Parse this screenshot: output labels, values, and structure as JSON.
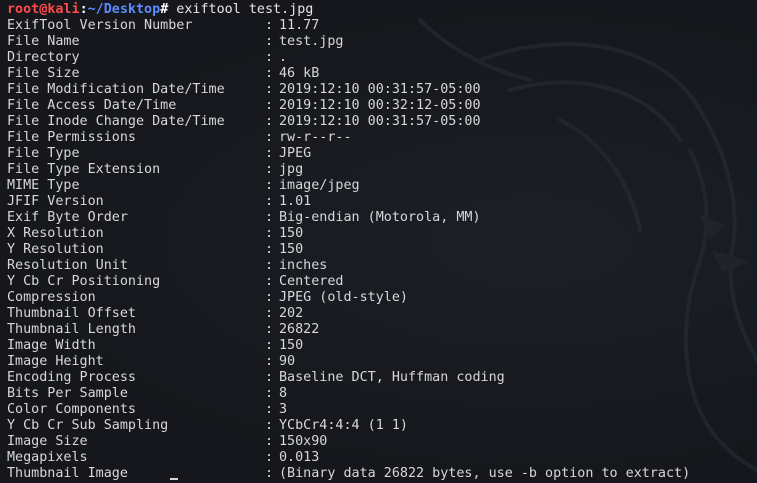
{
  "prompt": {
    "user": "root",
    "at": "@",
    "host": "kali",
    "colon": ":",
    "path": "~/Desktop",
    "hash": "#",
    "command": " exiftool test.jpg"
  },
  "separator": ":",
  "rows": [
    {
      "tag": "ExifTool Version Number",
      "value": "11.77"
    },
    {
      "tag": "File Name",
      "value": "test.jpg"
    },
    {
      "tag": "Directory",
      "value": "."
    },
    {
      "tag": "File Size",
      "value": "46 kB"
    },
    {
      "tag": "File Modification Date/Time",
      "value": "2019:12:10 00:31:57-05:00"
    },
    {
      "tag": "File Access Date/Time",
      "value": "2019:12:10 00:32:12-05:00"
    },
    {
      "tag": "File Inode Change Date/Time",
      "value": "2019:12:10 00:31:57-05:00"
    },
    {
      "tag": "File Permissions",
      "value": "rw-r--r--"
    },
    {
      "tag": "File Type",
      "value": "JPEG"
    },
    {
      "tag": "File Type Extension",
      "value": "jpg"
    },
    {
      "tag": "MIME Type",
      "value": "image/jpeg"
    },
    {
      "tag": "JFIF Version",
      "value": "1.01"
    },
    {
      "tag": "Exif Byte Order",
      "value": "Big-endian (Motorola, MM)"
    },
    {
      "tag": "X Resolution",
      "value": "150"
    },
    {
      "tag": "Y Resolution",
      "value": "150"
    },
    {
      "tag": "Resolution Unit",
      "value": "inches"
    },
    {
      "tag": "Y Cb Cr Positioning",
      "value": "Centered"
    },
    {
      "tag": "Compression",
      "value": "JPEG (old-style)"
    },
    {
      "tag": "Thumbnail Offset",
      "value": "202"
    },
    {
      "tag": "Thumbnail Length",
      "value": "26822"
    },
    {
      "tag": "Image Width",
      "value": "150"
    },
    {
      "tag": "Image Height",
      "value": "90"
    },
    {
      "tag": "Encoding Process",
      "value": "Baseline DCT, Huffman coding"
    },
    {
      "tag": "Bits Per Sample",
      "value": "8"
    },
    {
      "tag": "Color Components",
      "value": "3"
    },
    {
      "tag": "Y Cb Cr Sub Sampling",
      "value": "YCbCr4:4:4 (1 1)"
    },
    {
      "tag": "Image Size",
      "value": "150x90"
    },
    {
      "tag": "Megapixels",
      "value": "0.013"
    },
    {
      "tag": "Thumbnail Image",
      "value": "(Binary data 26822 bytes, use -b option to extract)"
    }
  ],
  "icons": {
    "background": "kali-dragon-icon"
  }
}
